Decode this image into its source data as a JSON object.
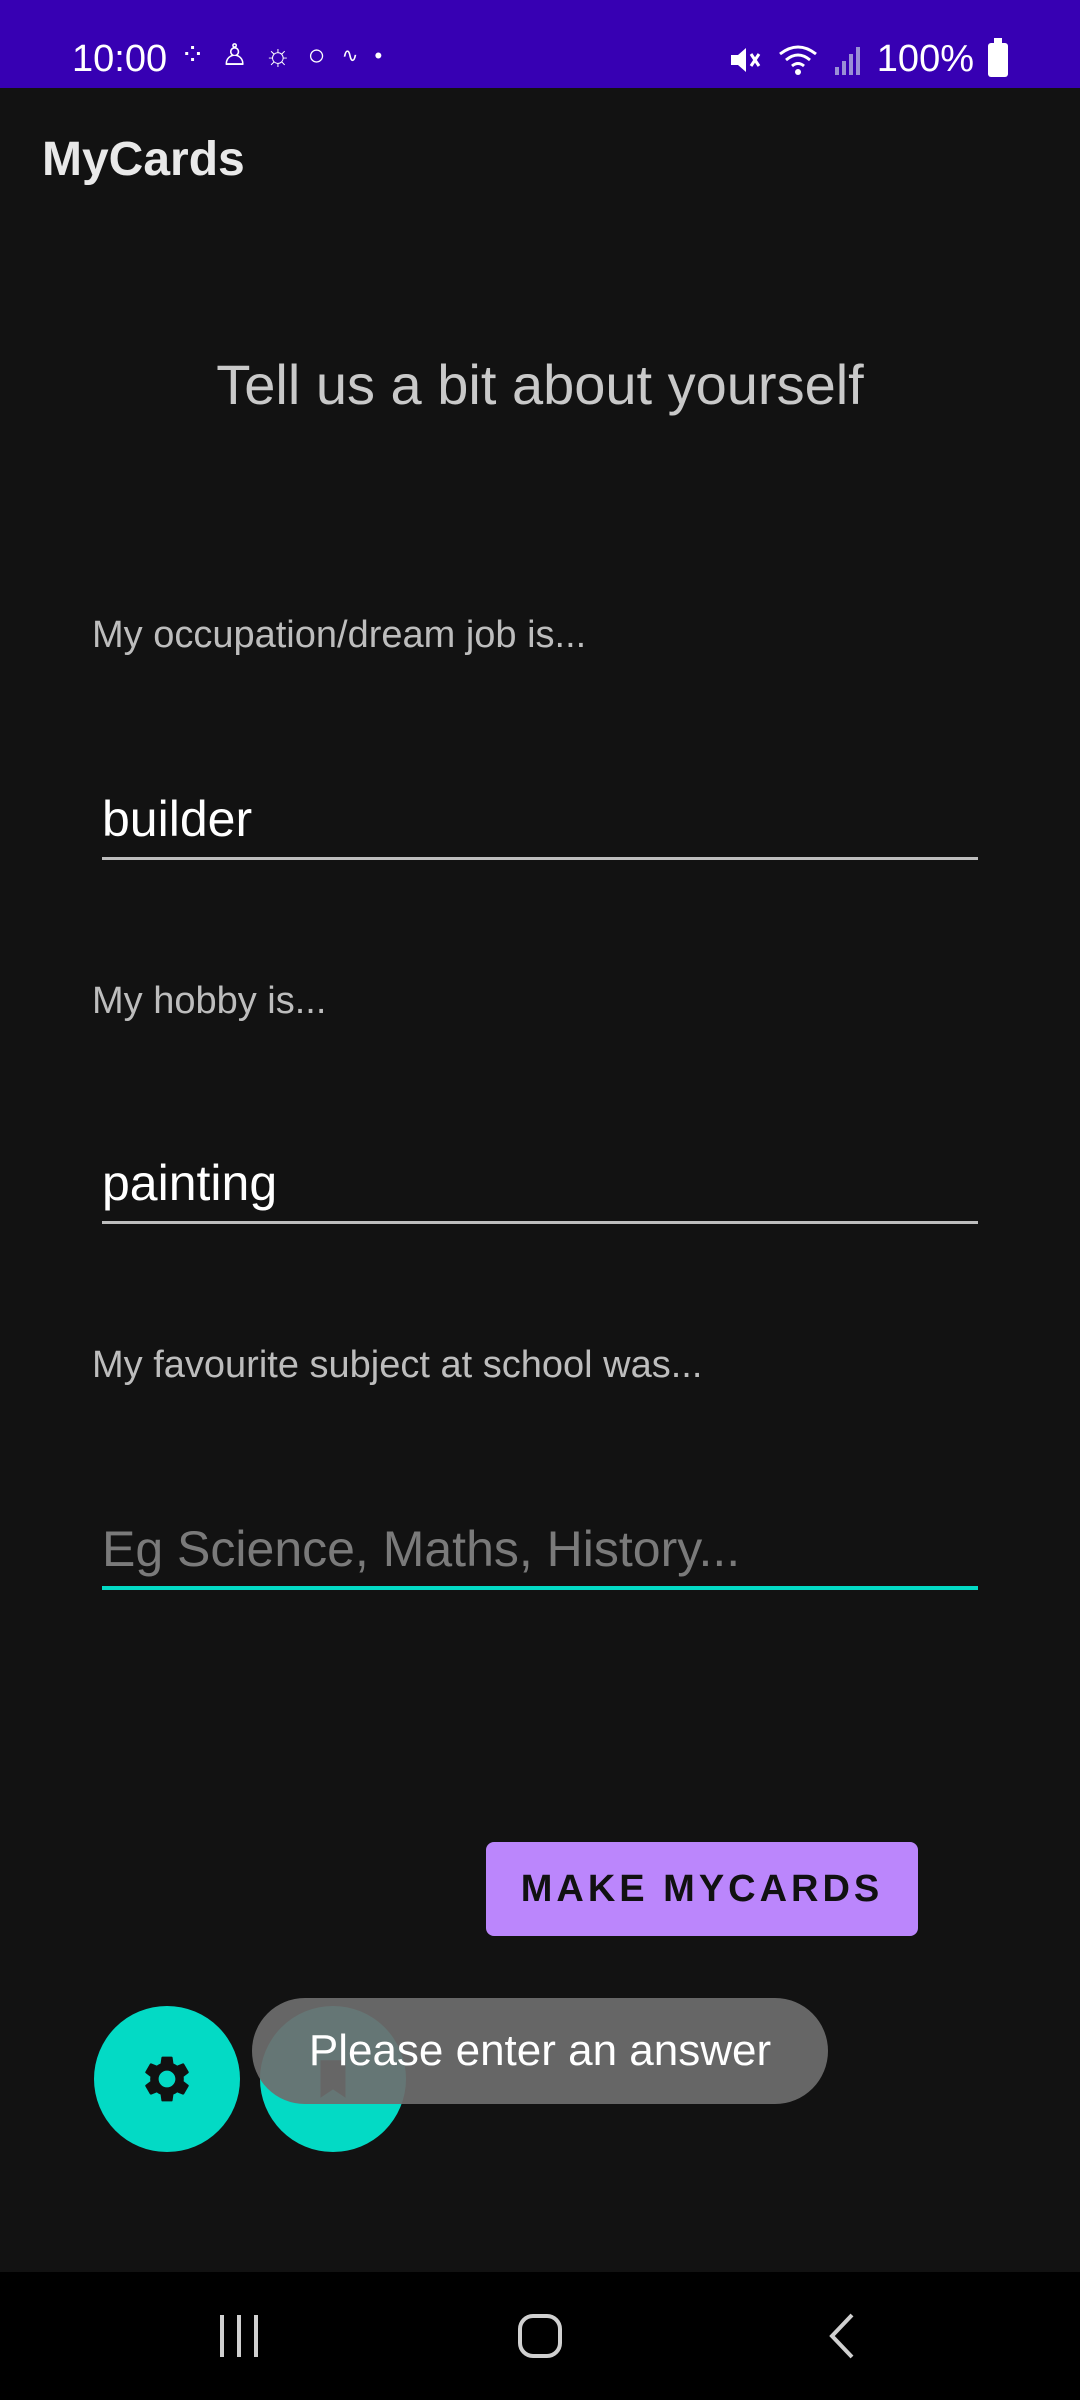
{
  "status_bar": {
    "time": "10:00",
    "battery": "100%"
  },
  "app": {
    "title": "MyCards"
  },
  "form": {
    "heading": "Tell us a bit about yourself",
    "occupation": {
      "label": "My occupation/dream job is...",
      "value": "builder"
    },
    "hobby": {
      "label": "My hobby is...",
      "value": "painting"
    },
    "subject": {
      "label": "My favourite subject at school was...",
      "value": "",
      "placeholder": "Eg Science, Maths, History..."
    },
    "submit_label": "MAKE MYCARDS"
  },
  "toast": {
    "message": "Please enter an answer"
  },
  "colors": {
    "status_bar": "#3700b3",
    "background": "#121212",
    "accent": "#03dac5",
    "button": "#bb86fc"
  },
  "icons": {
    "fab_primary": "gear-icon",
    "fab_secondary": "bookmark-icon"
  }
}
